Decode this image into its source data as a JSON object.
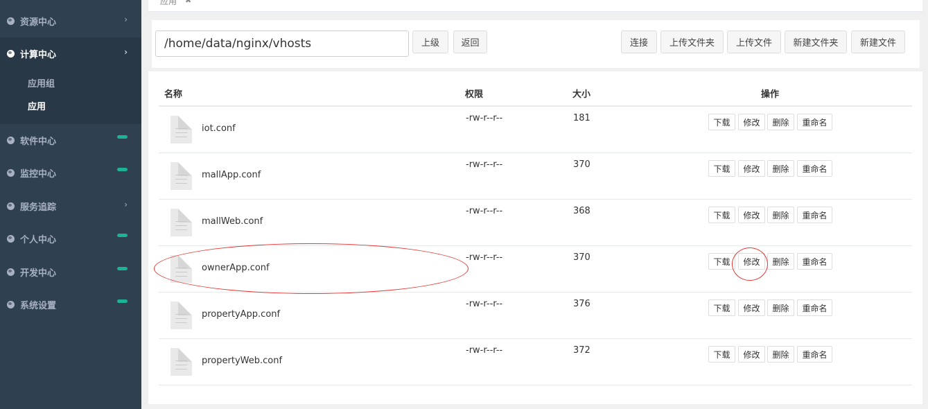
{
  "sidebar": {
    "items": [
      {
        "label": "资源中心",
        "marker": "chevron"
      },
      {
        "label": "计算中心",
        "marker": "chevron",
        "active": true
      },
      {
        "label": "软件中心",
        "marker": "pill"
      },
      {
        "label": "监控中心",
        "marker": "pill"
      },
      {
        "label": "服务追踪",
        "marker": "chevron"
      },
      {
        "label": "个人中心",
        "marker": "pill"
      },
      {
        "label": "开发中心",
        "marker": "pill"
      },
      {
        "label": "系统设置",
        "marker": "pill"
      }
    ],
    "submenu": [
      {
        "label": "应用组"
      },
      {
        "label": "应用",
        "active": true
      }
    ],
    "chevron_glyph": "›",
    "accent_color": "#1ab394"
  },
  "tabbar": {
    "active_tab": "应用",
    "close_glyph": "✖"
  },
  "toolbar": {
    "path_value": "/home/data/nginx/vhosts",
    "up_label": "上级",
    "back_label": "返回",
    "connect_label": "连接",
    "upload_folder_label": "上传文件夹",
    "upload_file_label": "上传文件",
    "new_folder_label": "新建文件夹",
    "new_file_label": "新建文件"
  },
  "table": {
    "headers": {
      "name": "名称",
      "perm": "权限",
      "size": "大小",
      "actions": "操作"
    },
    "action_labels": {
      "download": "下载",
      "edit": "修改",
      "delete": "删除",
      "rename": "重命名"
    },
    "rows": [
      {
        "name": "iot.conf",
        "perm": "-rw-r--r--",
        "size": "181"
      },
      {
        "name": "mallApp.conf",
        "perm": "-rw-r--r--",
        "size": "370"
      },
      {
        "name": "mallWeb.conf",
        "perm": "-rw-r--r--",
        "size": "368"
      },
      {
        "name": "ownerApp.conf",
        "perm": "-rw-r--r--",
        "size": "370",
        "highlighted": true
      },
      {
        "name": "propertyApp.conf",
        "perm": "-rw-r--r--",
        "size": "376"
      },
      {
        "name": "propertyWeb.conf",
        "perm": "-rw-r--r--",
        "size": "372"
      }
    ]
  },
  "annotation_color": "#e53935"
}
